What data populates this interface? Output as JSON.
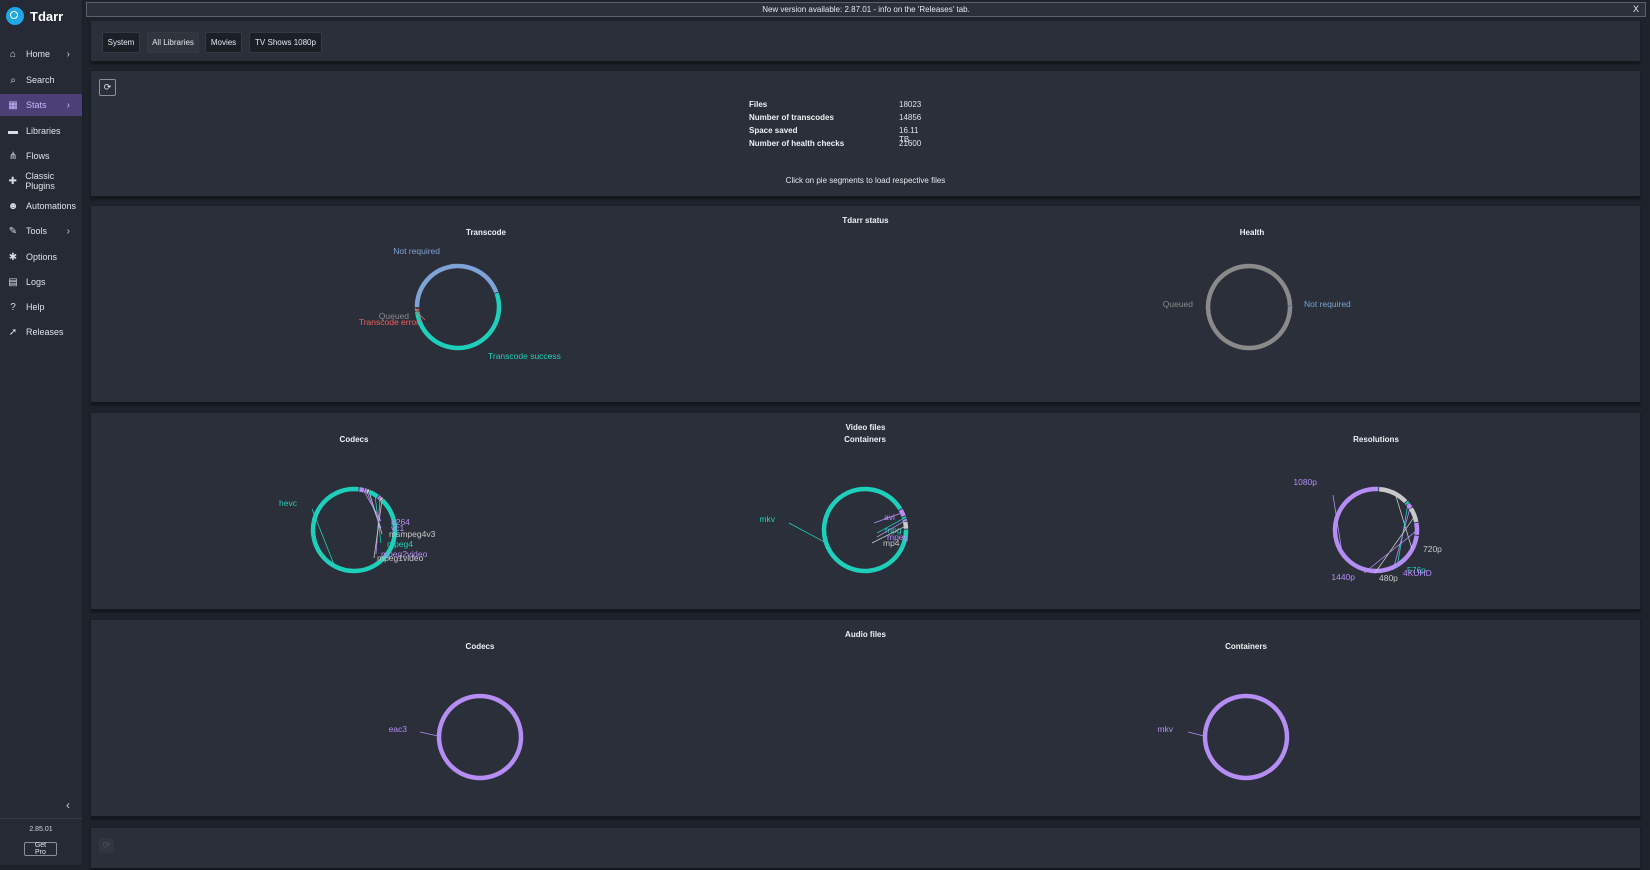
{
  "app": {
    "name": "Tdarr",
    "version": "2.85.01",
    "get_pro_label": "Get Pro"
  },
  "banner": {
    "text": "New version available: 2.87.01 - info on the 'Releases' tab.",
    "close_label": "X"
  },
  "sidebar": {
    "items": [
      {
        "key": "home",
        "label": "Home",
        "icon": "home-icon",
        "glyph": "⌂",
        "chevron": true,
        "active": false
      },
      {
        "key": "search",
        "label": "Search",
        "icon": "search-icon",
        "glyph": "⌕",
        "chevron": false,
        "active": false
      },
      {
        "key": "stats",
        "label": "Stats",
        "icon": "chart-icon",
        "glyph": "▦",
        "chevron": true,
        "active": true
      },
      {
        "key": "libraries",
        "label": "Libraries",
        "icon": "folder-icon",
        "glyph": "▬",
        "chevron": false,
        "active": false
      },
      {
        "key": "flows",
        "label": "Flows",
        "icon": "flow-icon",
        "glyph": "⋔",
        "chevron": false,
        "active": false
      },
      {
        "key": "classic-plugins",
        "label": "Classic Plugins",
        "icon": "puzzle-icon",
        "glyph": "✚",
        "chevron": false,
        "active": false
      },
      {
        "key": "automations",
        "label": "Automations",
        "icon": "robot-icon",
        "glyph": "☻",
        "chevron": false,
        "active": false
      },
      {
        "key": "tools",
        "label": "Tools",
        "icon": "wrench-icon",
        "glyph": "✎",
        "chevron": true,
        "active": false
      },
      {
        "key": "options",
        "label": "Options",
        "icon": "gear-icon",
        "glyph": "✱",
        "chevron": false,
        "active": false
      },
      {
        "key": "logs",
        "label": "Logs",
        "icon": "file-icon",
        "glyph": "▤",
        "chevron": false,
        "active": false
      },
      {
        "key": "help",
        "label": "Help",
        "icon": "help-icon",
        "glyph": "?",
        "chevron": false,
        "active": false
      },
      {
        "key": "releases",
        "label": "Releases",
        "icon": "rocket-icon",
        "glyph": "➚",
        "chevron": false,
        "active": false
      }
    ]
  },
  "tabs": [
    "System",
    "All Libraries",
    "Movies",
    "TV Shows 1080p"
  ],
  "stats": {
    "rows": [
      {
        "label": "Files",
        "value": "18023"
      },
      {
        "label": "Number of transcodes",
        "value": "14856"
      },
      {
        "label": "Space saved",
        "value": "16.11 TB"
      },
      {
        "label": "Number of health checks",
        "value": "21600"
      }
    ],
    "hint": "Click on pie segments to load respective files"
  },
  "sections": {
    "tdarr_status": "Tdarr status",
    "video_files": "Video files",
    "audio_files": "Audio files"
  },
  "colors": {
    "blue": "#7ea3d6",
    "teal": "#1ed0bb",
    "purple": "#b68cf5",
    "gray": "#8a8a8a",
    "lightgray": "#c9c9c9",
    "red": "#e8625c"
  },
  "chart_data": [
    {
      "type": "pie",
      "title": "Transcode",
      "categories": [
        "Not required",
        "Transcode success",
        "Transcode error",
        "Queued"
      ],
      "values": [
        44.5,
        54,
        1,
        0.5
      ],
      "colors": [
        "#7ea3d6",
        "#1ed0bb",
        "#e8625c",
        "#8a8a8a"
      ]
    },
    {
      "type": "pie",
      "title": "Health",
      "categories": [
        "Queued",
        "Not required"
      ],
      "values": [
        99.9,
        0.1
      ],
      "colors": [
        "#8a8a8a",
        "#7ea3d6"
      ]
    },
    {
      "type": "pie",
      "title": "Codecs",
      "categories": [
        "hevc",
        "h264",
        "vc1",
        "msmpeg4v3",
        "mpeg4",
        "mpeg2video",
        "mpeg1video"
      ],
      "values": [
        90,
        2,
        1,
        1,
        4,
        1,
        1
      ],
      "colors": [
        "#1ed0bb",
        "#b68cf5",
        "#b68cf5",
        "#c9c9c9",
        "#1ed0bb",
        "#b68cf5",
        "#c9c9c9"
      ]
    },
    {
      "type": "pie",
      "title": "Containers",
      "categories": [
        "mkv",
        "avi",
        "mpg",
        "mpeg",
        "mp4"
      ],
      "values": [
        92,
        3,
        1,
        1,
        3
      ],
      "colors": [
        "#1ed0bb",
        "#b68cf5",
        "#1ed0bb",
        "#b68cf5",
        "#c9c9c9"
      ]
    },
    {
      "type": "pie",
      "title": "Resolutions",
      "categories": [
        "1080p",
        "720p",
        "576p",
        "4KUHD",
        "480p",
        "1440p"
      ],
      "values": [
        74,
        12,
        1,
        2,
        6,
        5
      ],
      "colors": [
        "#b68cf5",
        "#c9c9c9",
        "#1ed0bb",
        "#b68cf5",
        "#c9c9c9",
        "#b68cf5"
      ]
    },
    {
      "type": "pie",
      "title": "Codecs",
      "categories": [
        "eac3"
      ],
      "values": [
        100
      ],
      "colors": [
        "#b68cf5"
      ]
    },
    {
      "type": "pie",
      "title": "Containers",
      "categories": [
        "mkv"
      ],
      "values": [
        100
      ],
      "colors": [
        "#b68cf5"
      ]
    }
  ]
}
